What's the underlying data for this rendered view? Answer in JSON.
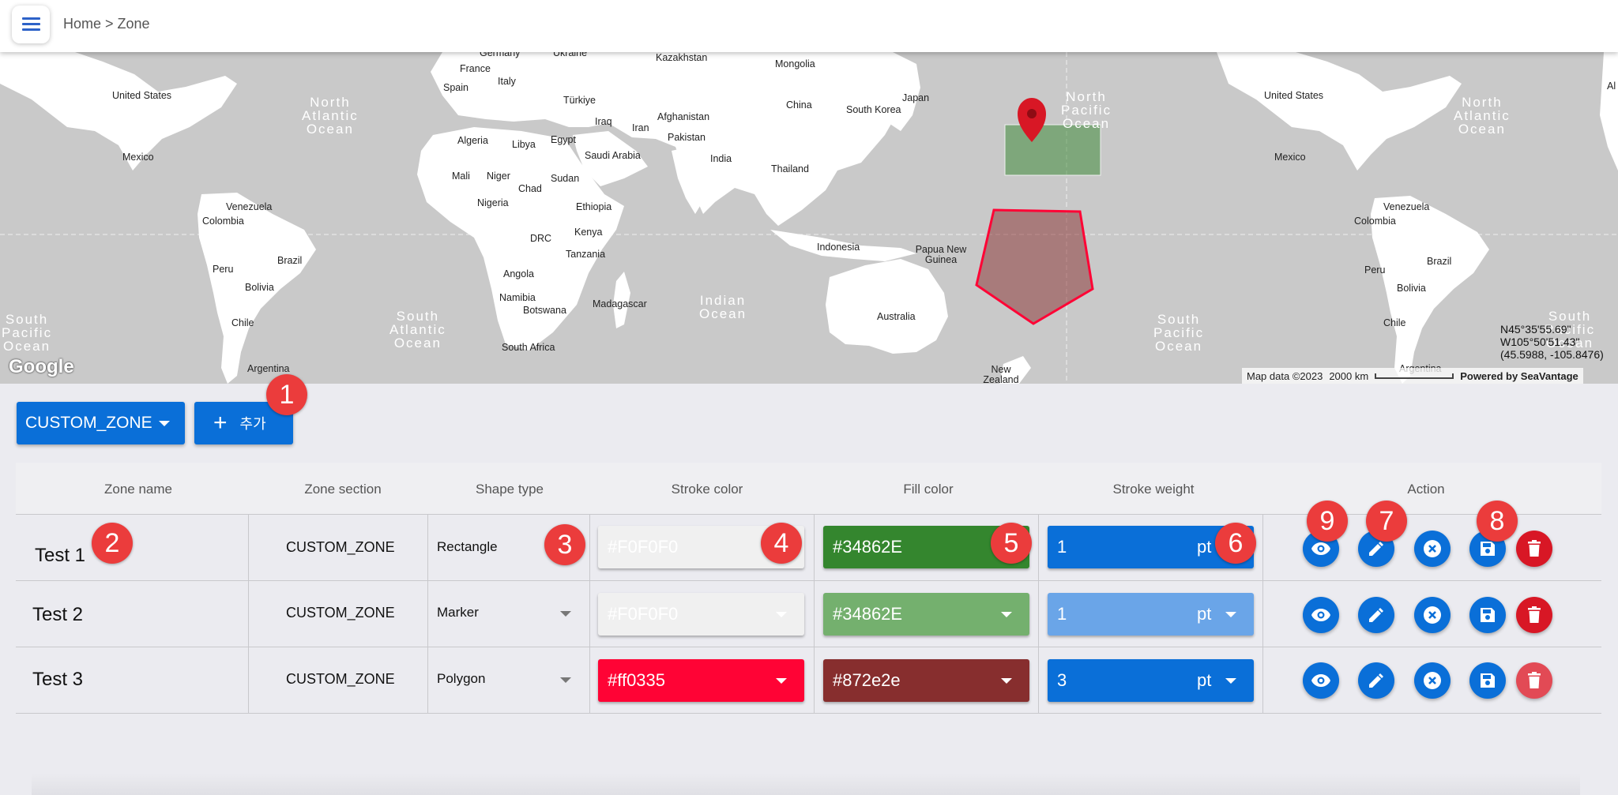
{
  "header": {
    "breadcrumb": "Home > Zone"
  },
  "map": {
    "countries": [
      {
        "name": "Germany",
        "id": "germany"
      },
      {
        "name": "Ukraine",
        "id": "ukraine"
      },
      {
        "name": "Kazakhstan",
        "id": "kazakhstan"
      },
      {
        "name": "Mongolia",
        "id": "mongolia"
      },
      {
        "name": "France",
        "id": "france"
      },
      {
        "name": "Italy",
        "id": "italy"
      },
      {
        "name": "Spain",
        "id": "spain"
      },
      {
        "name": "Türkiye",
        "id": "turkiye"
      },
      {
        "name": "China",
        "id": "china"
      },
      {
        "name": "Japan",
        "id": "japan"
      },
      {
        "name": "South Korea",
        "id": "south-korea"
      },
      {
        "name": "Afghanistan",
        "id": "afghanistan"
      },
      {
        "name": "Iraq",
        "id": "iraq"
      },
      {
        "name": "Iran",
        "id": "iran"
      },
      {
        "name": "Pakistan",
        "id": "pakistan"
      },
      {
        "name": "Algeria",
        "id": "algeria"
      },
      {
        "name": "Libya",
        "id": "libya"
      },
      {
        "name": "Egypt",
        "id": "egypt"
      },
      {
        "name": "Saudi Arabia",
        "id": "saudi-arabia"
      },
      {
        "name": "India",
        "id": "india"
      },
      {
        "name": "Thailand",
        "id": "thailand"
      },
      {
        "name": "Mali",
        "id": "mali"
      },
      {
        "name": "Niger",
        "id": "niger"
      },
      {
        "name": "Chad",
        "id": "chad"
      },
      {
        "name": "Sudan",
        "id": "sudan"
      },
      {
        "name": "Nigeria",
        "id": "nigeria"
      },
      {
        "name": "Ethiopia",
        "id": "ethiopia"
      },
      {
        "name": "Kenya",
        "id": "kenya"
      },
      {
        "name": "DRC",
        "id": "drc"
      },
      {
        "name": "Tanzania",
        "id": "tanzania"
      },
      {
        "name": "Angola",
        "id": "angola"
      },
      {
        "name": "Namibia",
        "id": "namibia"
      },
      {
        "name": "Botswana",
        "id": "botswana"
      },
      {
        "name": "Madagascar",
        "id": "madagascar"
      },
      {
        "name": "South Africa",
        "id": "south-africa"
      },
      {
        "name": "Indonesia",
        "id": "indonesia"
      },
      {
        "name": "Papua New Guinea",
        "id": "papua-new-guinea"
      },
      {
        "name": "Australia",
        "id": "australia"
      },
      {
        "name": "New Zealand",
        "id": "new-zealand"
      },
      {
        "name": "United States",
        "id": "united-states-left"
      },
      {
        "name": "Mexico",
        "id": "mexico-left"
      },
      {
        "name": "Venezuela",
        "id": "venezuela-left"
      },
      {
        "name": "Colombia",
        "id": "colombia-left"
      },
      {
        "name": "Brazil",
        "id": "brazil-left"
      },
      {
        "name": "Peru",
        "id": "peru-left"
      },
      {
        "name": "Bolivia",
        "id": "bolivia-left"
      },
      {
        "name": "Chile",
        "id": "chile-left"
      },
      {
        "name": "Argentina",
        "id": "argentina-left"
      },
      {
        "name": "United States",
        "id": "united-states-right"
      },
      {
        "name": "Mexico",
        "id": "mexico-right"
      },
      {
        "name": "Venezuela",
        "id": "venezuela-right"
      },
      {
        "name": "Colombia",
        "id": "colombia-right"
      },
      {
        "name": "Brazil",
        "id": "brazil-right"
      },
      {
        "name": "Peru",
        "id": "peru-right"
      },
      {
        "name": "Bolivia",
        "id": "bolivia-right"
      },
      {
        "name": "Chile",
        "id": "chile-right"
      },
      {
        "name": "Argentina",
        "id": "argentina-right"
      },
      {
        "name": "Al",
        "id": "al-right"
      }
    ],
    "oceans": [
      {
        "name": "North\nAtlantic\nOcean",
        "id": "north-atlantic-left"
      },
      {
        "name": "South\nAtlantic\nOcean",
        "id": "south-atlantic"
      },
      {
        "name": "South\nPacific\nOcean",
        "id": "south-pacific-left"
      },
      {
        "name": "Indian\nOcean",
        "id": "indian-ocean"
      },
      {
        "name": "North\nPacific\nOcean",
        "id": "north-pacific"
      },
      {
        "name": "South\nPacific\nOcean",
        "id": "south-pacific-right"
      },
      {
        "name": "North\nAtlantic\nOcean",
        "id": "north-atlantic-right"
      },
      {
        "name": "South\nPacific\nOcean",
        "id": "south-pacific-far-right"
      }
    ],
    "logo": "Google",
    "coords": "N45°35'55.69\"\nW105°50'51.43\"\n(45.5988, -105.8476)",
    "attribution": {
      "map_data": "Map data ©2023",
      "scale": "2000 km",
      "powered": "Powered by SeaVantage"
    },
    "shapes": {
      "rectangle_fill": "#34862E",
      "polygon_stroke": "#ff0335",
      "polygon_fill": "#872e2e",
      "marker_color": "#d81725"
    }
  },
  "toolbar": {
    "zone_select": "CUSTOM_ZONE",
    "add_label": "추가"
  },
  "table": {
    "headers": [
      "Zone name",
      "Zone section",
      "Shape type",
      "Stroke color",
      "Fill color",
      "Stroke weight",
      "Action"
    ],
    "rows": [
      {
        "name": "Test 1",
        "section": "CUSTOM_ZONE",
        "shape": "Rectangle",
        "stroke": "#F0F0F0",
        "fill": "#34862E",
        "weight": "1",
        "unit": "pt"
      },
      {
        "name": "Test 2",
        "section": "CUSTOM_ZONE",
        "shape": "Marker",
        "stroke": "#F0F0F0",
        "fill": "#34862E",
        "weight": "1",
        "unit": "pt"
      },
      {
        "name": "Test 3",
        "section": "CUSTOM_ZONE",
        "shape": "Polygon",
        "stroke": "#ff0335",
        "fill": "#872e2e",
        "weight": "3",
        "unit": "pt"
      }
    ]
  },
  "callouts": [
    "1",
    "2",
    "3",
    "4",
    "5",
    "6",
    "7",
    "8",
    "9"
  ]
}
